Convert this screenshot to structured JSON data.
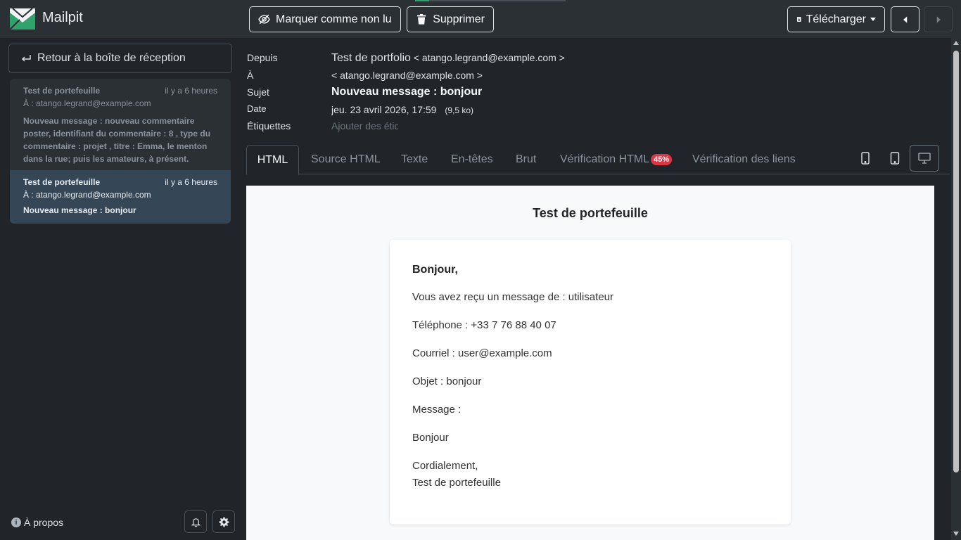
{
  "app": {
    "name": "Mailpit"
  },
  "toolbar": {
    "mark_unread": "Marquer comme non lu",
    "delete": "Supprimer",
    "download": "Télécharger"
  },
  "sidebar": {
    "back": "Retour à la boîte de réception",
    "messages": [
      {
        "from": "Test de portefeuille",
        "time": "il y a 6 heures",
        "to": "À : atango.legrand@example.com",
        "subject": "Nouveau message : nouveau commentaire poster, identifiant du commentaire : 8 , type du commentaire : projet , titre : Emma, le menton dans la rue; puis les amateurs, à présent."
      },
      {
        "from": "Test de portefeuille",
        "time": "il y a 6 heures",
        "to": "À : atango.legrand@example.com",
        "subject": "Nouveau message : bonjour"
      }
    ],
    "about": "À propos"
  },
  "header": {
    "from_label": "Depuis",
    "from_name": "Test de portfolio",
    "from_email": "< atango.legrand@example.com >",
    "to_label": "À",
    "to_email": "< atango.legrand@example.com >",
    "subject_label": "Sujet",
    "subject": "Nouveau message : bonjour",
    "date_label": "Date",
    "date": "jeu. 23 avril 2026, 17:59",
    "size": "(9,5 ko)",
    "tags_label": "Étiquettes",
    "tags_placeholder": "Ajouter des étiquettes"
  },
  "tabs": {
    "html": "HTML",
    "html_source": "Source HTML",
    "text": "Texte",
    "headers": "En-têtes",
    "raw": "Brut",
    "html_check": "Vérification HTML",
    "html_check_badge": "45%",
    "link_check": "Vérification des liens"
  },
  "email": {
    "title": "Test de portefeuille",
    "greeting": "Bonjour,",
    "line_from": "Vous avez reçu un message de : utilisateur",
    "line_phone": "Téléphone : +33 7 76 88 40 07",
    "line_email": "Courriel : user@example.com",
    "line_subject": "Objet : bonjour",
    "line_message": "Message :",
    "line_body": "Bonjour",
    "closing": "Cordialement,",
    "signature": "Test de portefeuille"
  },
  "colors": {
    "accent": "#2fa36b",
    "badge": "#dc3545",
    "selected": "#354657"
  }
}
